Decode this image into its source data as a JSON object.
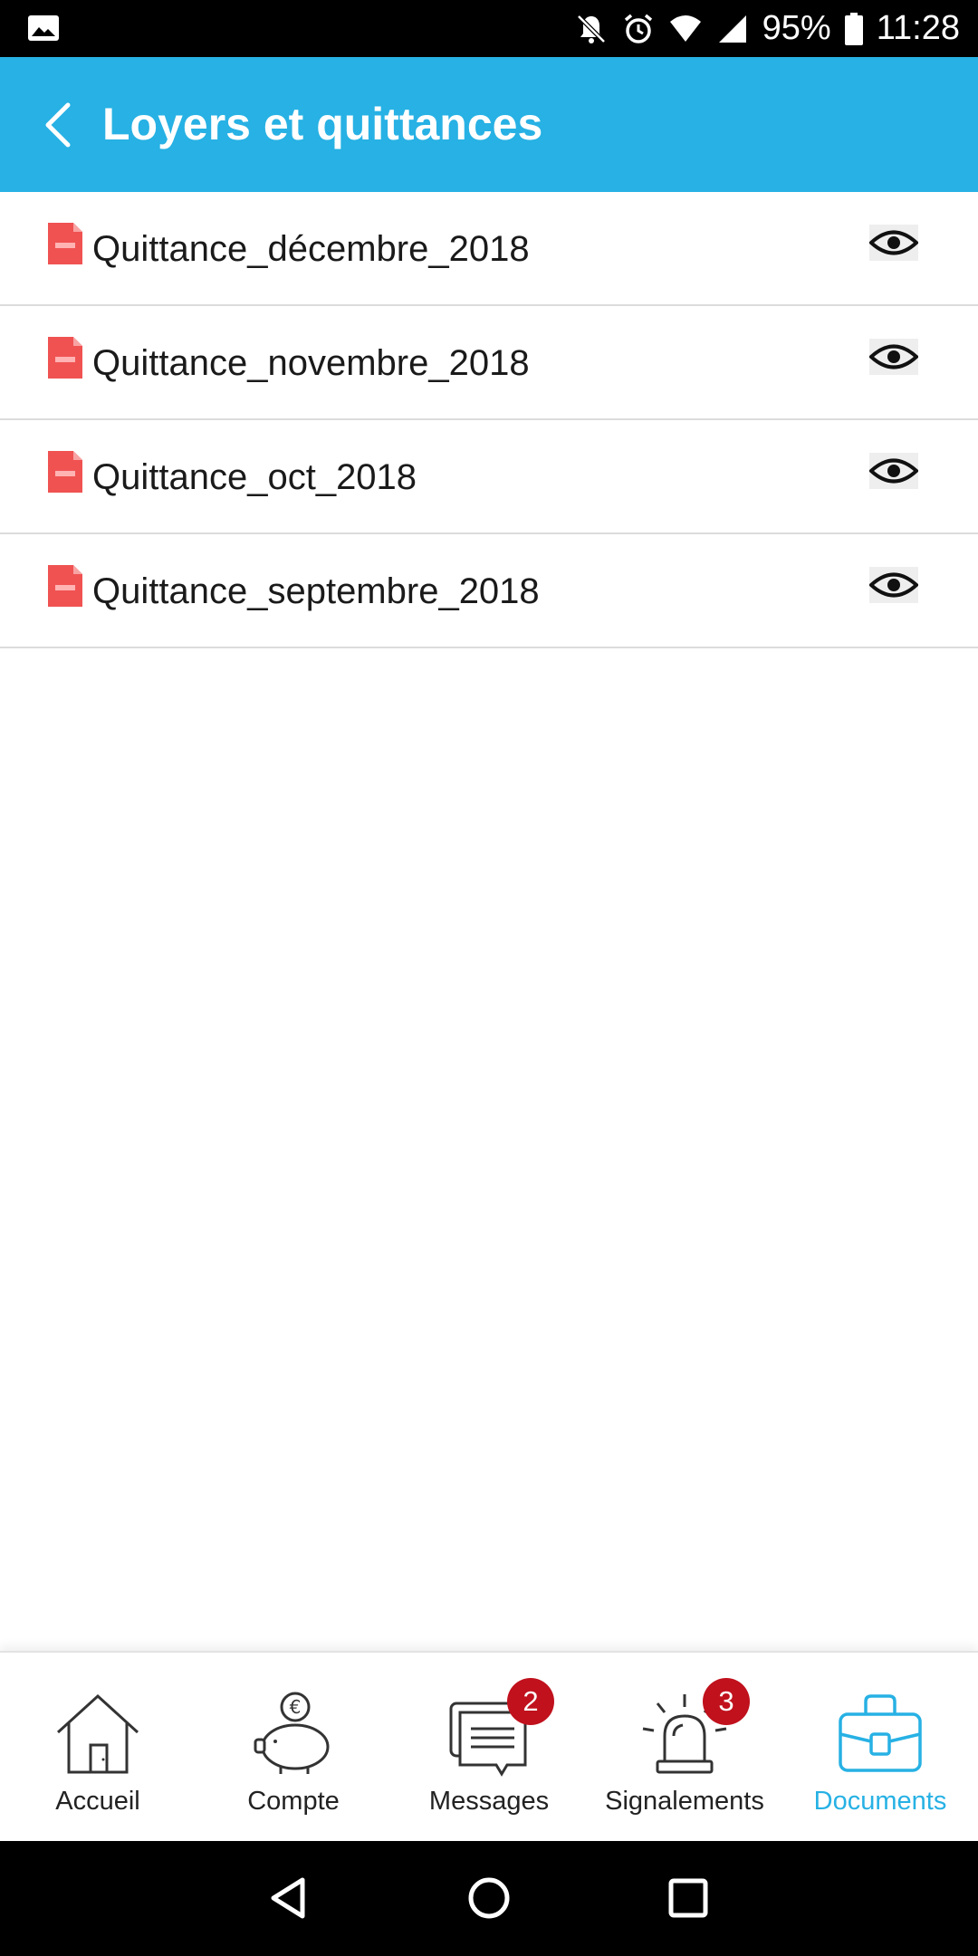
{
  "status_bar": {
    "battery": "95%",
    "time": "11:28",
    "icons": [
      "image-icon",
      "notifications-off-icon",
      "alarm-icon",
      "wifi-icon",
      "signal-icon",
      "battery-icon"
    ]
  },
  "header": {
    "title": "Loyers et quittances",
    "back_icon": "chevron-left-icon",
    "background": "#27b1e4"
  },
  "documents": [
    {
      "name": "Quittance_décembre_2018"
    },
    {
      "name": "Quittance_novembre_2018"
    },
    {
      "name": "Quittance_oct_2018"
    },
    {
      "name": "Quittance_septembre_2018"
    }
  ],
  "bottom_nav": {
    "items": [
      {
        "label": "Accueil",
        "icon": "home-icon"
      },
      {
        "label": "Compte",
        "icon": "piggy-bank-icon"
      },
      {
        "label": "Messages",
        "icon": "messages-icon",
        "badge": "2"
      },
      {
        "label": "Signalements",
        "icon": "alarm-light-icon",
        "badge": "3"
      },
      {
        "label": "Documents",
        "icon": "briefcase-icon",
        "active": true
      }
    ],
    "active_color": "#27b1e4",
    "badge_color": "#c0111d"
  },
  "system_nav": {
    "icons": [
      "back-triangle-icon",
      "home-circle-icon",
      "recents-square-icon"
    ]
  }
}
